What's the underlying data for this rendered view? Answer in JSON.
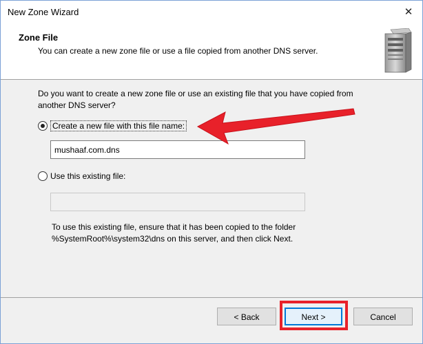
{
  "window": {
    "title": "New Zone Wizard",
    "close_glyph": "✕"
  },
  "header": {
    "title": "Zone File",
    "subtitle": "You can create a new zone file or use a file copied from another DNS server.",
    "icon": "server-icon"
  },
  "body": {
    "question": "Do you want to create a new zone file or use an existing file that you have copied from another DNS server?",
    "option_new": {
      "label": "Create a new file with this file name:",
      "selected": true
    },
    "new_file_value": "mushaaf.com.dns",
    "option_existing": {
      "label": "Use this existing file:",
      "selected": false
    },
    "existing_file_value": "",
    "note": "To use this existing file, ensure that it has been copied to the folder %SystemRoot%\\system32\\dns on this server, and then click Next."
  },
  "buttons": {
    "back": "< Back",
    "next": "Next >",
    "cancel": "Cancel"
  },
  "colors": {
    "annotation": "#e8212a",
    "focus": "#0078d7"
  }
}
